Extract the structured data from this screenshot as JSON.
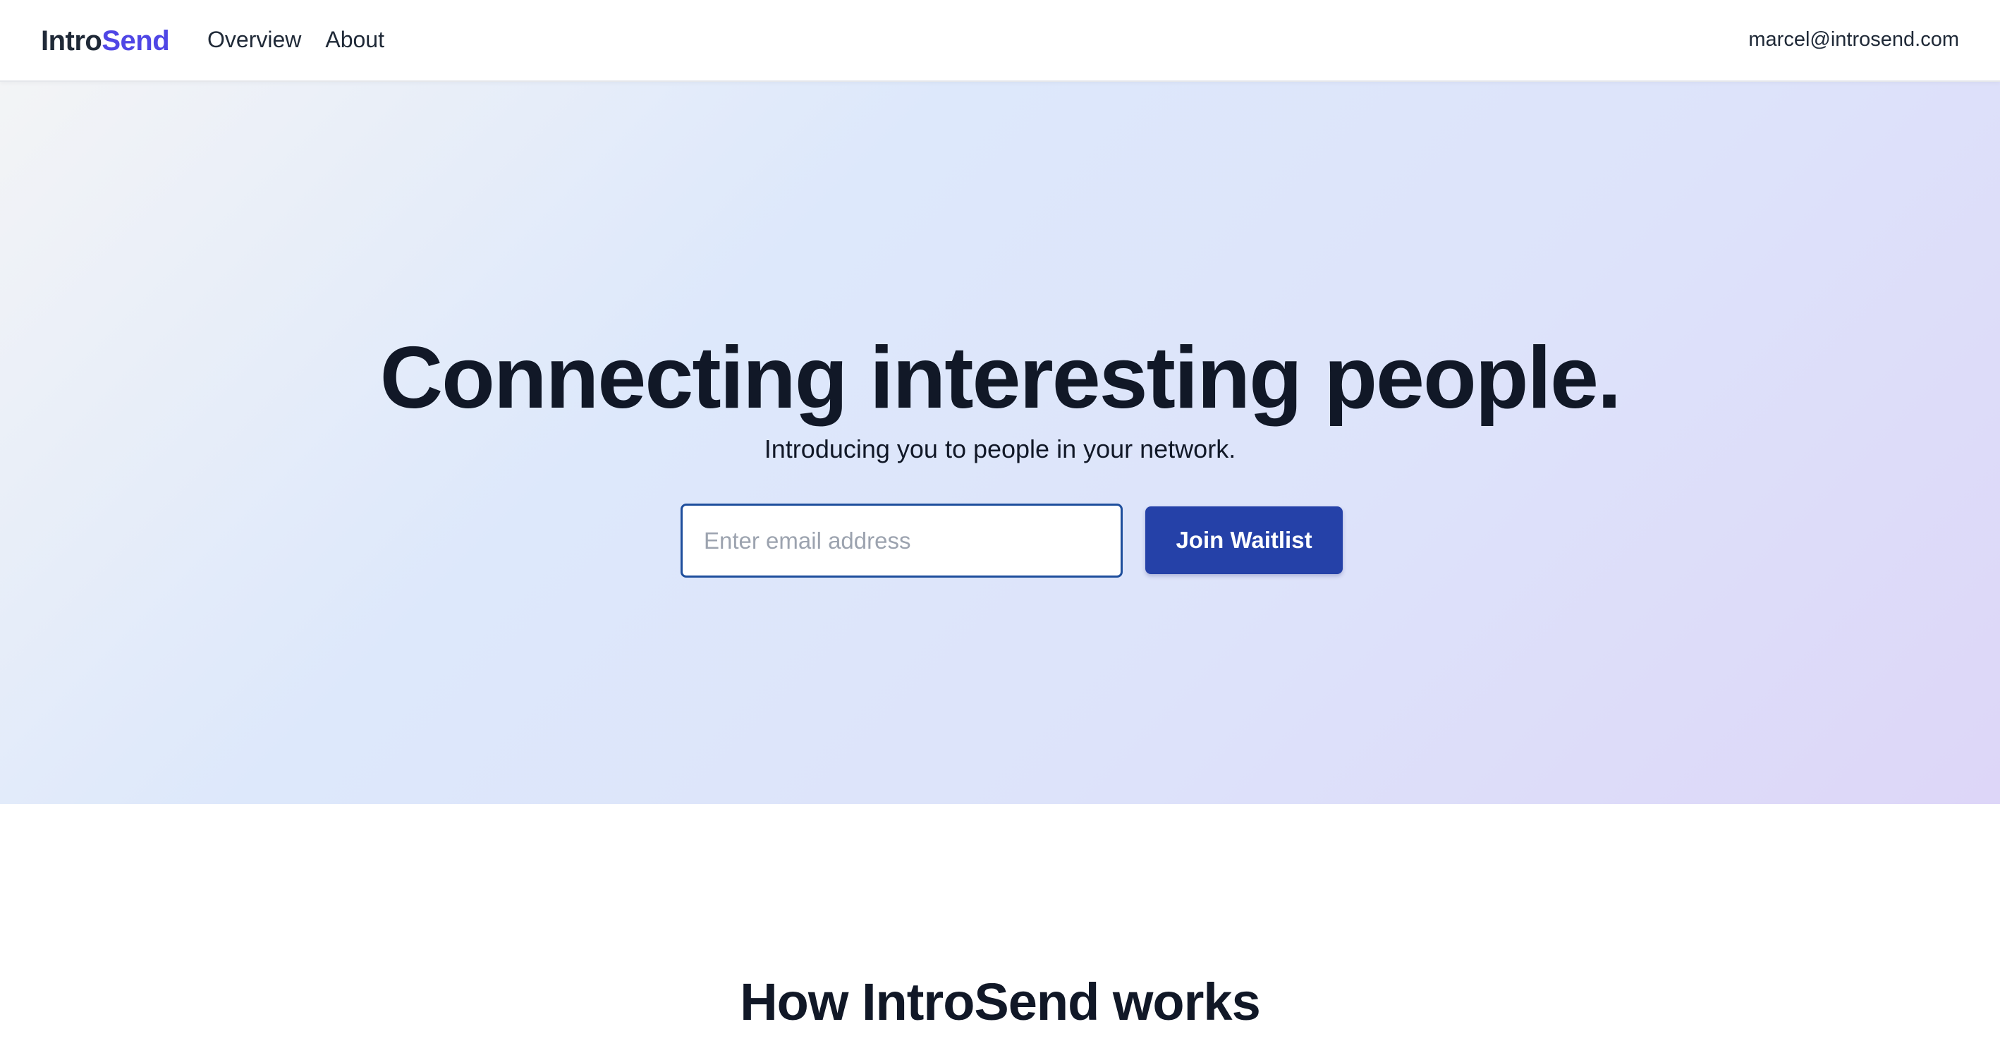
{
  "header": {
    "brand_part1": "Intro",
    "brand_part2": "Send",
    "nav": [
      {
        "label": "Overview"
      },
      {
        "label": "About"
      }
    ],
    "contact_email": "marcel@introsend.com"
  },
  "hero": {
    "title": "Connecting interesting people.",
    "subtitle": "Introducing you to people in your network.",
    "email_placeholder": "Enter email address",
    "email_value": "",
    "cta_label": "Join Waitlist"
  },
  "how_it_works": {
    "title": "How IntroSend works"
  },
  "colors": {
    "brand_accent": "#4f46e5",
    "cta_background": "#2541a8",
    "input_border": "#1e4e9c",
    "text_dark": "#111827"
  }
}
